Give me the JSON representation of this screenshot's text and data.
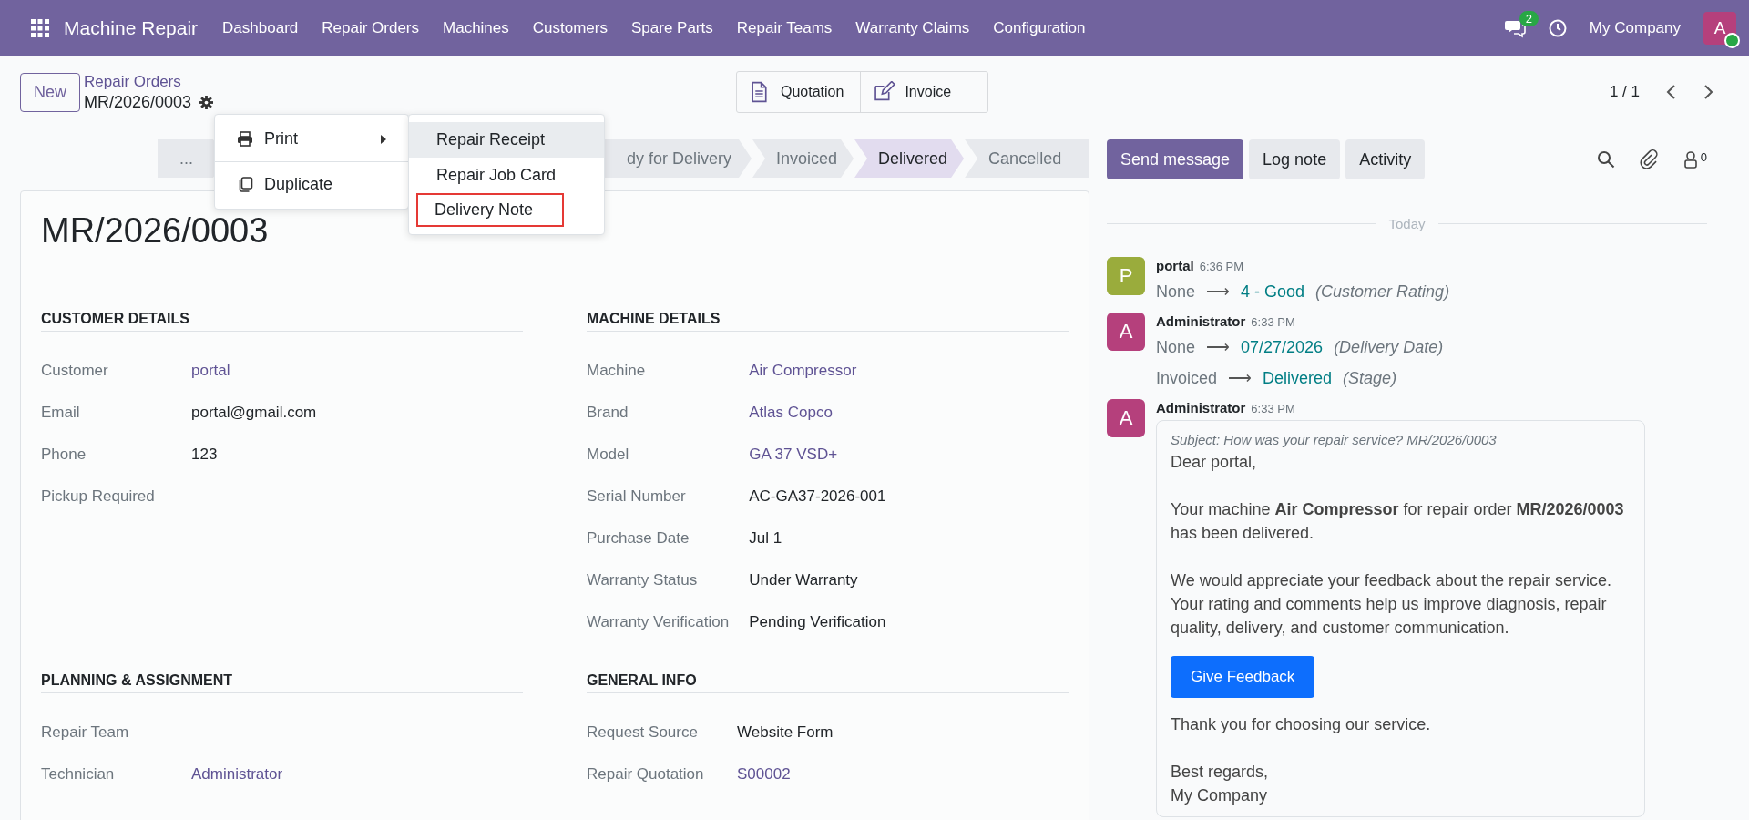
{
  "navbar": {
    "app_name": "Machine Repair",
    "menu": [
      "Dashboard",
      "Repair Orders",
      "Machines",
      "Customers",
      "Spare Parts",
      "Repair Teams",
      "Warranty Claims",
      "Configuration"
    ],
    "messages_badge": "2",
    "company": "My Company",
    "avatar_initial": "A",
    "online": true
  },
  "control_panel": {
    "new_button": "New",
    "breadcrumb": "Repair Orders",
    "record": "MR/2026/0003",
    "smart_buttons": [
      {
        "label": "Quotation",
        "kind": "document"
      },
      {
        "label": "Invoice",
        "kind": "edit"
      }
    ],
    "pager": "1 / 1"
  },
  "action_menu": {
    "items": [
      {
        "label": "Print",
        "kind": "print",
        "expanded": true
      },
      {
        "label": "Duplicate",
        "kind": "copy",
        "expanded": false
      }
    ],
    "submenu": [
      {
        "label": "Repair Receipt",
        "selected": true,
        "outlined": false
      },
      {
        "label": "Repair Job Card",
        "selected": false,
        "outlined": false
      },
      {
        "label": "Delivery Note",
        "selected": false,
        "outlined": true
      }
    ]
  },
  "status_bar": [
    {
      "label": "...",
      "selected": false
    },
    {
      "label": "dy for Delivery",
      "selected": false
    },
    {
      "label": "Invoiced",
      "selected": false
    },
    {
      "label": "Delivered",
      "selected": true
    },
    {
      "label": "Cancelled",
      "selected": false
    }
  ],
  "form": {
    "title": "MR/2026/0003",
    "groups": [
      {
        "title": "CUSTOMER DETAILS",
        "fields": [
          {
            "label": "Customer",
            "value": "portal",
            "kind": "link"
          },
          {
            "label": "Email",
            "value": "portal@gmail.com",
            "kind": "text"
          },
          {
            "label": "Phone",
            "value": "123",
            "kind": "text"
          },
          {
            "label": "Pickup Required",
            "kind": "empty"
          }
        ]
      },
      {
        "title": "MACHINE DETAILS",
        "fields": [
          {
            "label": "Machine",
            "value": "Air Compressor",
            "kind": "link"
          },
          {
            "label": "Brand",
            "value": "Atlas Copco",
            "kind": "link"
          },
          {
            "label": "Model",
            "value": "GA 37 VSD+",
            "kind": "link"
          },
          {
            "label": "Serial Number",
            "value": "AC-GA37-2026-001",
            "kind": "text"
          },
          {
            "label": "Purchase Date",
            "value": "Jul 1",
            "kind": "text"
          },
          {
            "label": "Warranty Status",
            "value": "Under Warranty",
            "kind": "text"
          },
          {
            "label": "Warranty Verification",
            "value": "Pending Verification",
            "kind": "text"
          }
        ]
      },
      {
        "title": "PLANNING & ASSIGNMENT",
        "fields": [
          {
            "label": "Repair Team",
            "kind": "empty"
          },
          {
            "label": "Technician",
            "value": "Administrator",
            "kind": "link"
          }
        ]
      },
      {
        "title": "GENERAL INFO",
        "fields": [
          {
            "label": "Request Source",
            "value": "Website Form",
            "kind": "text"
          },
          {
            "label": "Repair Quotation",
            "value": "S00002",
            "kind": "link"
          }
        ]
      }
    ]
  },
  "chatter": {
    "buttons": [
      {
        "label": "Send message",
        "selected": true
      },
      {
        "label": "Log note",
        "selected": false
      },
      {
        "label": "Activity",
        "selected": false
      }
    ],
    "followers_count": "0",
    "date_separator": "Today",
    "messages": [
      {
        "author": "portal",
        "time": "6:36 PM",
        "avatar": "P",
        "color": "#9aac3c",
        "changes": [
          {
            "old": "None",
            "arrow": "⟶",
            "new": "4 - Good",
            "field": "(Customer Rating)"
          }
        ]
      },
      {
        "author": "Administrator",
        "time": "6:33 PM",
        "avatar": "A",
        "color": "#b5407c",
        "changes": [
          {
            "old": "None",
            "arrow": "⟶",
            "new": "07/27/2026",
            "field": "(Delivery Date)"
          },
          {
            "old": "Invoiced",
            "arrow": "⟶",
            "new": "Delivered",
            "field": "(Stage)"
          }
        ]
      },
      {
        "author": "Administrator",
        "time": "6:33 PM",
        "avatar": "A",
        "color": "#b5407c",
        "body": [
          {
            "kind": "subject",
            "text": "Subject: How was your repair service? MR/2026/0003"
          },
          {
            "kind": "para",
            "text": "Dear portal,"
          },
          {
            "kind": "para",
            "text": "Your machine **Air Compressor** for repair order **MR/2026/0003** has been delivered."
          },
          {
            "kind": "para",
            "text": "We would appreciate your feedback about the repair service. Your rating and comments help us improve diagnosis, repair quality, delivery, and customer communication."
          },
          {
            "kind": "button",
            "text": "Give Feedback"
          },
          {
            "kind": "para",
            "text": "Thank you for choosing our service."
          },
          {
            "kind": "para",
            "text": "Best regards,\nMy Company"
          }
        ]
      }
    ]
  }
}
